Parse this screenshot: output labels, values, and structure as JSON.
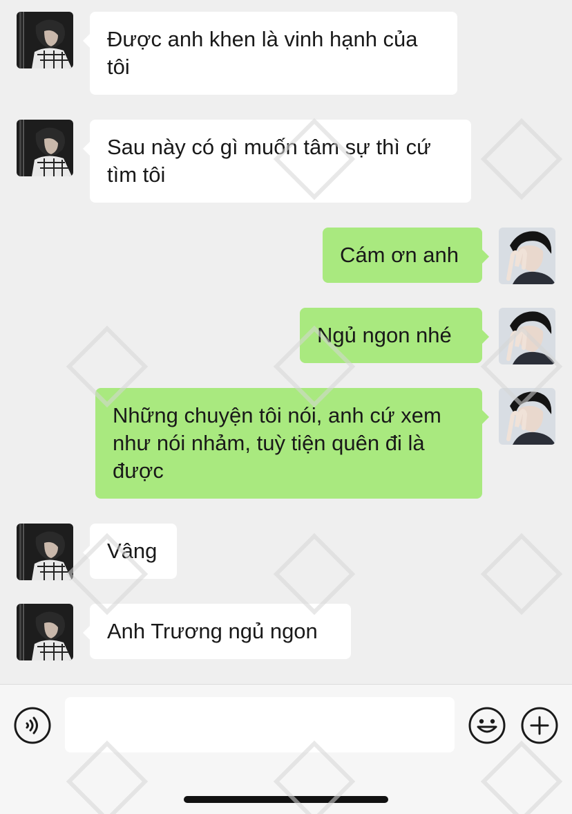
{
  "messages": [
    {
      "side": "in",
      "text": "Được anh khen là vinh hạnh của tôi"
    },
    {
      "side": "in",
      "text": "Sau này có gì muốn tâm sự thì cứ tìm tôi"
    },
    {
      "side": "out",
      "text": "Cám ơn anh"
    },
    {
      "side": "out",
      "text": "Ngủ ngon nhé"
    },
    {
      "side": "out",
      "text": "Những chuyện tôi nói, anh cứ xem như nói nhảm, tuỳ tiện quên đi là được"
    },
    {
      "side": "in",
      "text": "Vâng"
    },
    {
      "side": "in",
      "text": "Anh Trương ngủ ngon"
    }
  ],
  "input": {
    "placeholder": "",
    "voice_icon": "voice-icon",
    "emoji_icon": "emoji-icon",
    "add_icon": "plus-icon"
  },
  "colors": {
    "background": "#efefef",
    "incoming_bubble": "#ffffff",
    "outgoing_bubble": "#a9e97f",
    "text": "#191919"
  }
}
